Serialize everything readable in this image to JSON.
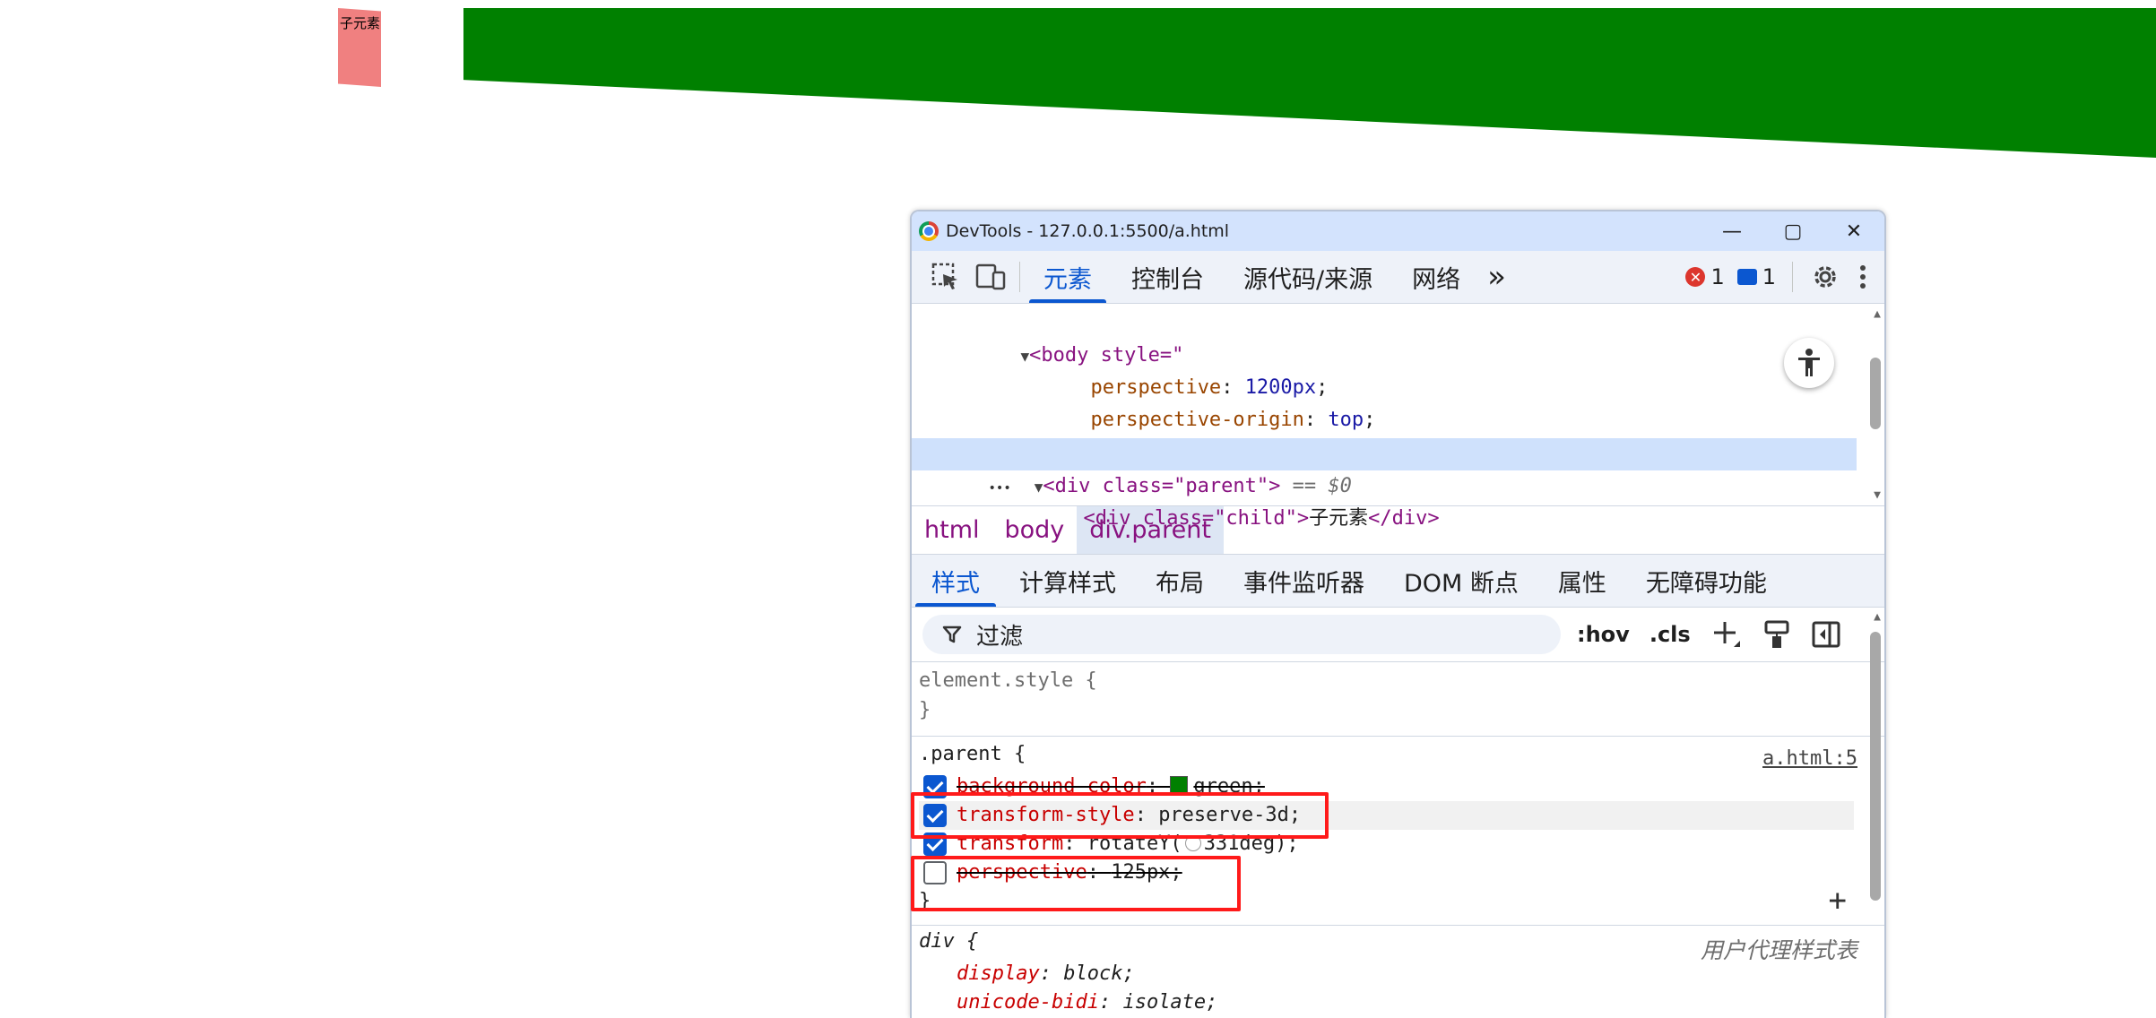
{
  "page": {
    "child_text": "子元素"
  },
  "devtools": {
    "window_title": "DevTools - 127.0.0.1:5500/a.html",
    "window_buttons": {
      "minimize": "—",
      "maximize": "▢",
      "close": "✕"
    },
    "tabs": [
      "元素",
      "控制台",
      "源代码/来源",
      "网络"
    ],
    "more_tabs": "»",
    "error_count": "1",
    "message_count": "1",
    "dom": {
      "body_open": "<body style=\"",
      "css_line_1_prop": "perspective",
      "css_line_1_val": "1200px",
      "css_line_2_prop": "perspective-origin",
      "css_line_2_val": "top",
      "body_close": "\">",
      "ellipsis": "•••",
      "parent_tag_open": "<div class=",
      "parent_class": "\"parent\"",
      "parent_tag_end": ">",
      "selected_marker": "== $0",
      "child_tag_open": "<div class=",
      "child_class": "\"child\"",
      "child_tag_end": ">",
      "child_text": "子元素",
      "child_close": "</div>"
    },
    "breadcrumbs": [
      "html",
      "body",
      "div.parent"
    ],
    "subtabs": [
      "样式",
      "计算样式",
      "布局",
      "事件监听器",
      "DOM 断点",
      "属性",
      "无障碍功能"
    ],
    "filter": {
      "placeholder": "过滤",
      "hov": ":hov",
      "cls": ".cls"
    },
    "styles": {
      "element_style_open": "element.style {",
      "close_brace": "}",
      "parent_selector": ".parent {",
      "parent_source": "a.html:5",
      "decls": [
        {
          "prop": "background-color",
          "value": "green;",
          "checked": true,
          "overridden": true
        },
        {
          "prop": "transform-style",
          "value": "preserve-3d;",
          "checked": true,
          "overridden": false
        },
        {
          "prop": "transform",
          "value": "rotateY(",
          "value_after": "331deg);",
          "checked": true,
          "overridden": false
        },
        {
          "prop": "perspective",
          "value": "125px;",
          "checked": false,
          "overridden": true
        }
      ],
      "div_selector": "div {",
      "div_source": "用户代理样式表",
      "div_decls": [
        {
          "prop": "display",
          "value": "block;"
        },
        {
          "prop": "unicode-bidi",
          "value": "isolate;"
        }
      ]
    },
    "colors": {
      "accent": "#0b57d0",
      "swatch_green": "#008000",
      "highlight_red": "#ff1a1a"
    }
  }
}
